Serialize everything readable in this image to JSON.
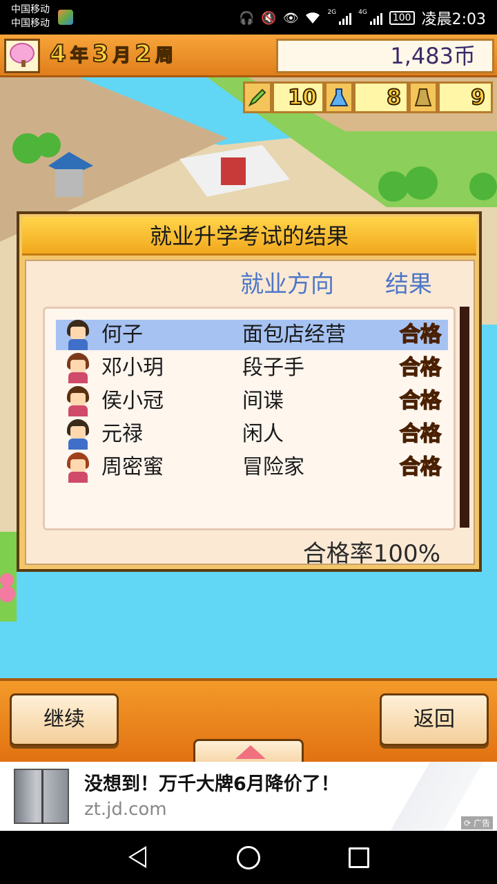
{
  "statusbar": {
    "carrier1": "中国移动",
    "carrier2": "中国移动",
    "net1": "2G",
    "net2": "4G",
    "battery": "100",
    "time": "凌晨2:03",
    "icons": [
      "headphone-icon",
      "mute-icon",
      "eye-icon",
      "wifi-icon",
      "signal-icon",
      "signal-icon"
    ]
  },
  "hud": {
    "year_num": "4",
    "year_unit": "年",
    "month_num": "3",
    "month_unit": "月",
    "week_num": "2",
    "week_unit": "周",
    "money": "1,483币",
    "stats": [
      {
        "icon": "pencil-icon",
        "value": "10"
      },
      {
        "icon": "flask-icon",
        "value": "8"
      },
      {
        "icon": "trophy-icon",
        "value": "9"
      }
    ]
  },
  "dialog": {
    "title": "就业升学考试的结果",
    "col_career": "就业方向",
    "col_result": "结果",
    "rows": [
      {
        "name": "何子",
        "career": "面包店经营",
        "result": "合格"
      },
      {
        "name": "邓小玥",
        "career": "段子手",
        "result": "合格"
      },
      {
        "name": "侯小冠",
        "career": "间谍",
        "result": "合格"
      },
      {
        "name": "元禄",
        "career": "闲人",
        "result": "合格"
      },
      {
        "name": "周密蜜",
        "career": "冒险家",
        "result": "合格"
      }
    ],
    "pass_rate": "合格率100%"
  },
  "buttons": {
    "continue": "继续",
    "back": "返回"
  },
  "ad": {
    "title": "没想到！万千大牌6月降价了！",
    "url": "zt.jd.com",
    "tag": "广告"
  }
}
